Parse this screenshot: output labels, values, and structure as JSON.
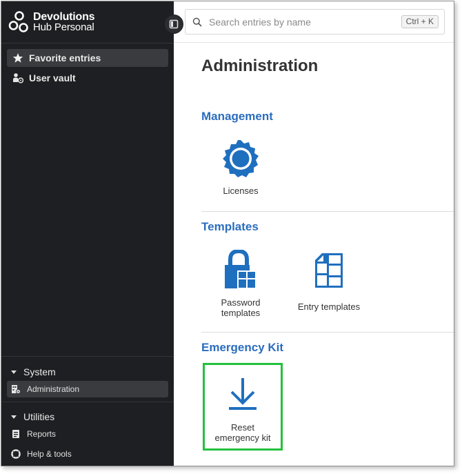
{
  "brand": {
    "line1": "Devolutions",
    "line2": "Hub Personal"
  },
  "search": {
    "placeholder": "Search entries by name",
    "shortcut": "Ctrl + K"
  },
  "nav": {
    "favorite": "Favorite entries",
    "user_vault": "User vault"
  },
  "sections": {
    "system": {
      "label": "System",
      "items": [
        {
          "label": "Administration"
        }
      ]
    },
    "utilities": {
      "label": "Utilities",
      "items": [
        {
          "label": "Reports"
        },
        {
          "label": "Help & tools"
        }
      ]
    }
  },
  "main": {
    "title": "Administration",
    "groups": {
      "management": {
        "title": "Management",
        "tiles": [
          {
            "label": "Licenses"
          }
        ]
      },
      "templates": {
        "title": "Templates",
        "tiles": [
          {
            "label": "Password templates"
          },
          {
            "label": "Entry templates"
          }
        ]
      },
      "emergency": {
        "title": "Emergency Kit",
        "tiles": [
          {
            "label": "Reset emergency kit"
          }
        ]
      }
    }
  },
  "colors": {
    "accent": "#1f6fbf",
    "sidebar_bg": "#1e1f22",
    "highlight": "#22c13b",
    "group_title": "#2a6dbf"
  },
  "icons": {
    "brand": "devolutions-logo",
    "collapse": "sidebar-toggle-icon",
    "search": "search-icon",
    "favorite": "star-icon",
    "user_vault": "user-vault-icon",
    "administration": "administration-icon",
    "reports": "reports-icon",
    "help": "lifebuoy-icon",
    "licenses": "license-badge-icon",
    "password_templates": "password-template-icon",
    "entry_templates": "entry-template-icon",
    "emergency": "download-arrow-icon"
  }
}
